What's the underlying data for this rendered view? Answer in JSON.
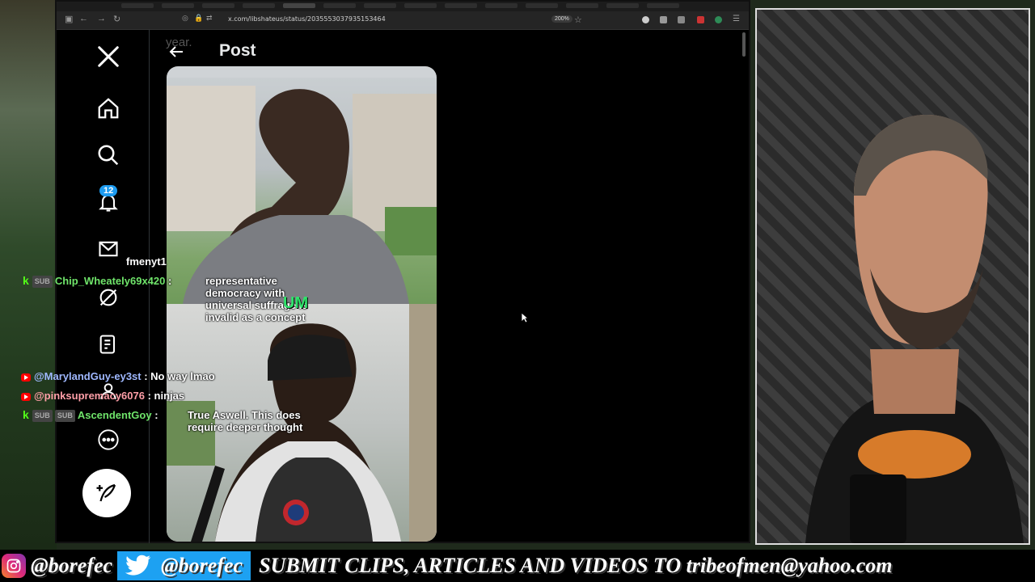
{
  "browser": {
    "url": "x.com/libshateus/status/2035553037935153464",
    "zoom": "200%"
  },
  "x_nav": {
    "notification_count": "12",
    "items": [
      "x-logo",
      "home",
      "search",
      "notifications",
      "messages",
      "grok",
      "lists",
      "profile",
      "more"
    ]
  },
  "post": {
    "title": "Post",
    "ghost_text": "year.",
    "overlay_text": "UM"
  },
  "chat": [
    {
      "username": "fmenyt1",
      "message": "",
      "platform": "none",
      "badges": []
    },
    {
      "username": "Chip_Wheately69x420",
      "message": "representative democracy with universal suffrage is invalid as a concept",
      "platform": "kick",
      "badges": [
        "SUB"
      ]
    },
    {
      "username": "@MarylandGuy-ey3st",
      "message": "No way lmao",
      "platform": "youtube",
      "badges": []
    },
    {
      "username": "@pinksupremacy6076",
      "message": "ninjas",
      "platform": "youtube",
      "badges": []
    },
    {
      "username": "AscendentGoy",
      "message": "True Aswell. This does require deeper thought",
      "platform": "kick",
      "badges": [
        "SUB",
        "SUB"
      ]
    }
  ],
  "banner": {
    "instagram_handle": "@borefec",
    "twitter_handle": "@borefec",
    "submit_text": "SUBMIT CLIPS, ARTICLES AND VIDEOS TO tribeofmen@yahoo.com"
  },
  "colors": {
    "twitter_blue": "#1d9bf0",
    "kick_green": "#53fc18",
    "youtube_red": "#ff0000"
  }
}
